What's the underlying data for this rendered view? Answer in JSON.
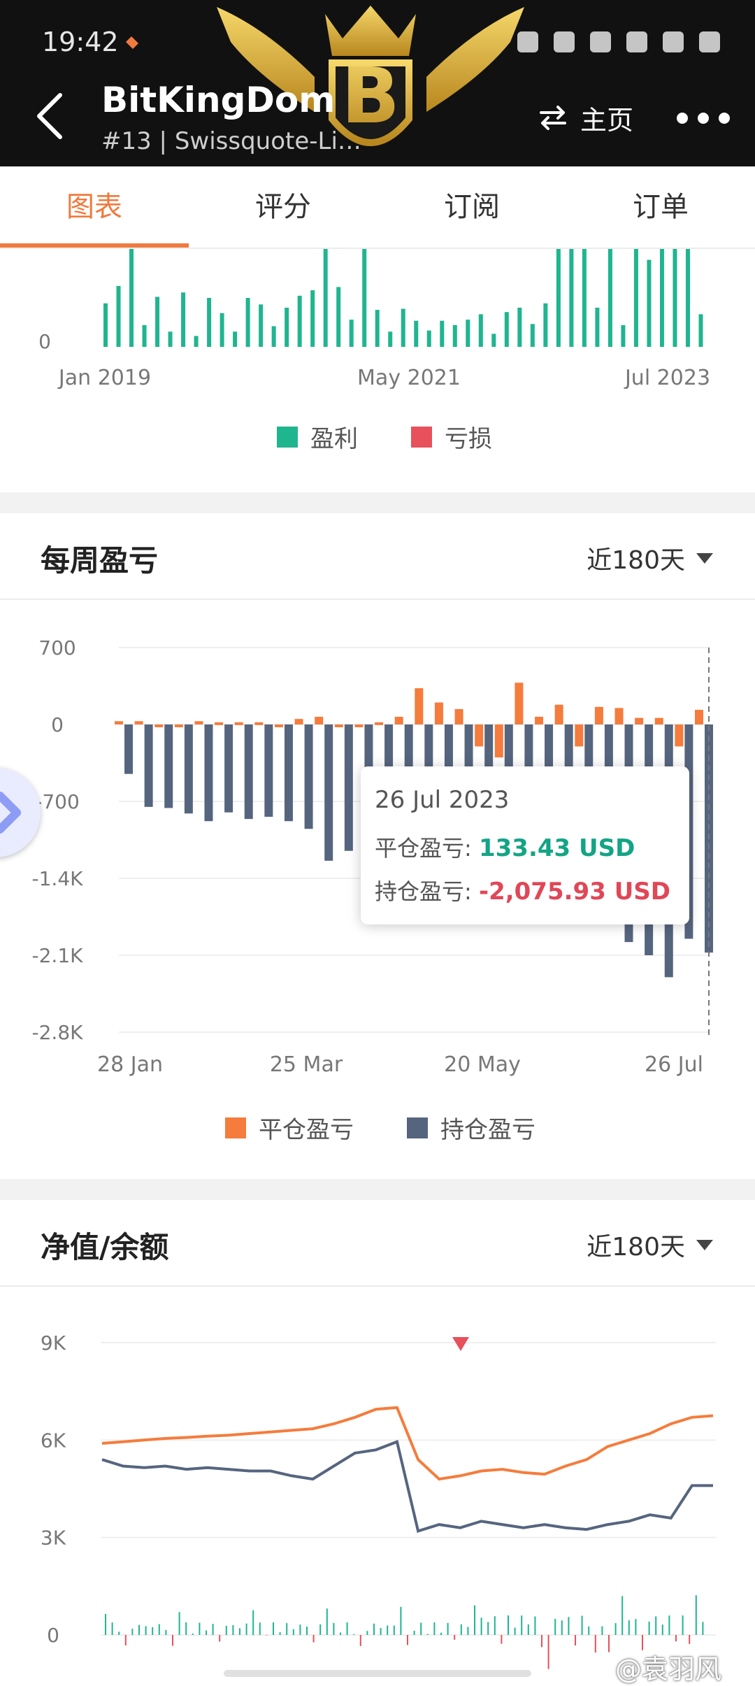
{
  "header": {
    "status_time": "19:42",
    "title": "BitKingDom",
    "subtitle": "#13 | Swissquote-Li…",
    "home_label": "主页"
  },
  "tabs": [
    {
      "label": "图表",
      "active": true
    },
    {
      "label": "评分",
      "active": false
    },
    {
      "label": "订阅",
      "active": false
    },
    {
      "label": "订单",
      "active": false
    }
  ],
  "colors": {
    "accent": "#f07a3e",
    "profit": "#1fb58f",
    "loss": "#e8505b",
    "closed": "#f57c3c",
    "floating": "#56657e",
    "equity": "#f57c3c",
    "balance": "#56657e"
  },
  "monthly_chart": {
    "y_zero_label": "0",
    "x_labels": [
      "Jan 2019",
      "May 2021",
      "Jul 2023"
    ],
    "legend": [
      "盈利",
      "亏损"
    ]
  },
  "weekly": {
    "title": "每周盈亏",
    "period": "近180天",
    "legend": [
      "平仓盈亏",
      "持仓盈亏"
    ],
    "tooltip": {
      "date": "26 Jul 2023",
      "closed_label": "平仓盈亏:",
      "closed_value": "133.43 USD",
      "floating_label": "持仓盈亏:",
      "floating_value": "-2,075.93 USD"
    }
  },
  "equity": {
    "title": "净值/余额",
    "period": "近180天"
  },
  "watermark": "@袁羽风",
  "chart_data": [
    {
      "type": "bar",
      "title": "",
      "series": [
        {
          "name": "盈利",
          "values": [
            400,
            560,
            900,
            200,
            460,
            140,
            500,
            100,
            450,
            310,
            140,
            450,
            390,
            190,
            360,
            470,
            520,
            900,
            550,
            250,
            900,
            340,
            140,
            350,
            240,
            150,
            240,
            200,
            250,
            300,
            120,
            320,
            360,
            210,
            400,
            900,
            900,
            900,
            360,
            900,
            200,
            900,
            800,
            900,
            900,
            900,
            300
          ]
        },
        {
          "name": "亏损",
          "values": []
        }
      ],
      "x_labels": [
        "Jan 2019",
        "May 2021",
        "Jul 2023"
      ],
      "y_ticks": [
        "0"
      ]
    },
    {
      "type": "bar",
      "title": "每周盈亏",
      "categories_labels": [
        "28 Jan",
        "25 Mar",
        "20 May",
        "26 Jul"
      ],
      "ylim": [
        -2800,
        700
      ],
      "y_ticks": [
        "700",
        "0",
        "-700",
        "-1.4K",
        "-2.1K",
        "-2.8K"
      ],
      "series": [
        {
          "name": "平仓盈亏",
          "values": [
            30,
            30,
            0,
            0,
            30,
            20,
            20,
            20,
            0,
            50,
            70,
            -20,
            0,
            20,
            70,
            330,
            200,
            140,
            -200,
            -300,
            380,
            70,
            180,
            -200,
            160,
            150,
            60,
            60,
            -200,
            133.43
          ]
        },
        {
          "name": "持仓盈亏",
          "values": [
            -450,
            -750,
            -760,
            -810,
            -880,
            -800,
            -860,
            -840,
            -880,
            -950,
            -1240,
            -1150,
            -1100,
            -700,
            -600,
            -500,
            -450,
            -450,
            -400,
            -650,
            -700,
            -500,
            -500,
            -600,
            -600,
            -1980,
            -2100,
            -2300,
            -1950,
            -2075.93
          ]
        }
      ]
    },
    {
      "type": "line",
      "title": "净值/余额",
      "y_ticks": [
        "9K",
        "6K",
        "3K",
        "0"
      ],
      "ylim": [
        0,
        9000
      ],
      "series": [
        {
          "name": "",
          "values": [
            5900,
            5950,
            6000,
            6050,
            6080,
            6120,
            6150,
            6200,
            6250,
            6300,
            6350,
            6500,
            6700,
            6950,
            7000,
            5400,
            4800,
            4900,
            5050,
            5100,
            5000,
            4950,
            5200,
            5400,
            5800,
            6000,
            6200,
            6500,
            6700,
            6750
          ]
        },
        {
          "name": "",
          "values": [
            5400,
            5200,
            5150,
            5200,
            5100,
            5150,
            5100,
            5050,
            5050,
            4900,
            4800,
            5200,
            5600,
            5700,
            5950,
            3200,
            3400,
            3300,
            3500,
            3400,
            3300,
            3400,
            3300,
            3250,
            3400,
            3500,
            3700,
            3600,
            4600,
            4600
          ]
        }
      ]
    }
  ]
}
